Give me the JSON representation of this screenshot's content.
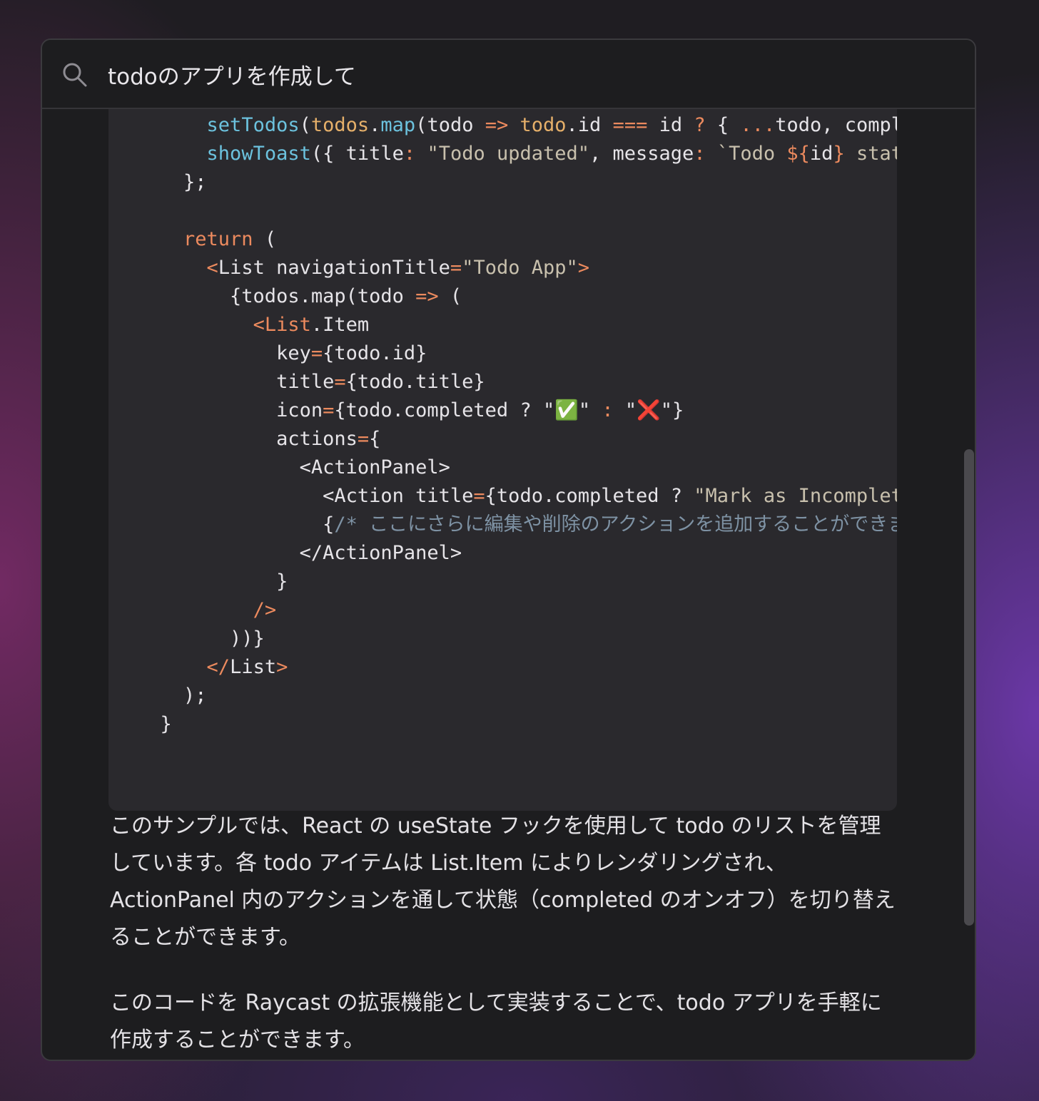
{
  "search": {
    "query": "todoのアプリを作成して"
  },
  "code": {
    "lines": [
      [
        {
          "t": "      "
        },
        {
          "t": "setTodos",
          "c": "tok-fn"
        },
        {
          "t": "("
        },
        {
          "t": "todos",
          "c": "tok-var"
        },
        {
          "t": "."
        },
        {
          "t": "map",
          "c": "tok-fn"
        },
        {
          "t": "(todo "
        },
        {
          "t": "=>",
          "c": "tok-op"
        },
        {
          "t": " "
        },
        {
          "t": "todo",
          "c": "tok-var"
        },
        {
          "t": ".id "
        },
        {
          "t": "===",
          "c": "tok-op"
        },
        {
          "t": " id "
        },
        {
          "t": "?",
          "c": "tok-op"
        },
        {
          "t": " { "
        },
        {
          "t": "...",
          "c": "tok-op"
        },
        {
          "t": "todo, compl"
        }
      ],
      [
        {
          "t": "      "
        },
        {
          "t": "showToast",
          "c": "tok-fn"
        },
        {
          "t": "({ title"
        },
        {
          "t": ":",
          "c": "tok-op"
        },
        {
          "t": " "
        },
        {
          "t": "\"Todo updated\"",
          "c": "tok-str"
        },
        {
          "t": ", message"
        },
        {
          "t": ":",
          "c": "tok-op"
        },
        {
          "t": " "
        },
        {
          "t": "`Todo ",
          "c": "tok-str"
        },
        {
          "t": "${",
          "c": "tok-op"
        },
        {
          "t": "id"
        },
        {
          "t": "}",
          "c": "tok-op"
        },
        {
          "t": " stat",
          "c": "tok-str"
        }
      ],
      [
        {
          "t": "    };"
        }
      ],
      [
        {
          "t": ""
        }
      ],
      [
        {
          "t": "    "
        },
        {
          "t": "return",
          "c": "tok-kw"
        },
        {
          "t": " ("
        }
      ],
      [
        {
          "t": "      "
        },
        {
          "t": "<",
          "c": "tok-op"
        },
        {
          "t": "List navigationTitle"
        },
        {
          "t": "=",
          "c": "tok-op"
        },
        {
          "t": "\"Todo App\"",
          "c": "tok-str"
        },
        {
          "t": ">",
          "c": "tok-op"
        }
      ],
      [
        {
          "t": "        {todos.map(todo "
        },
        {
          "t": "=>",
          "c": "tok-op"
        },
        {
          "t": " ("
        }
      ],
      [
        {
          "t": "          "
        },
        {
          "t": "<List",
          "c": "tok-op"
        },
        {
          "t": ".Item"
        }
      ],
      [
        {
          "t": "            key"
        },
        {
          "t": "=",
          "c": "tok-op"
        },
        {
          "t": "{todo.id}"
        }
      ],
      [
        {
          "t": "            title"
        },
        {
          "t": "=",
          "c": "tok-op"
        },
        {
          "t": "{todo.title}"
        }
      ],
      [
        {
          "t": "            icon"
        },
        {
          "t": "=",
          "c": "tok-op"
        },
        {
          "t": "{todo.completed ? \"✅\" "
        },
        {
          "t": ":",
          "c": "tok-op"
        },
        {
          "t": " \"❌\"}"
        }
      ],
      [
        {
          "t": "            actions"
        },
        {
          "t": "=",
          "c": "tok-op"
        },
        {
          "t": "{"
        }
      ],
      [
        {
          "t": "              <ActionPanel>"
        }
      ],
      [
        {
          "t": "                <Action title"
        },
        {
          "t": "=",
          "c": "tok-op"
        },
        {
          "t": "{todo.completed ? "
        },
        {
          "t": "\"Mark as Incomplet",
          "c": "tok-str"
        }
      ],
      [
        {
          "t": "                {"
        },
        {
          "t": "/* ここにさらに編集や削除のアクションを追加することができま",
          "c": "tok-cm"
        }
      ],
      [
        {
          "t": "              </ActionPanel>"
        }
      ],
      [
        {
          "t": "            }"
        }
      ],
      [
        {
          "t": "          "
        },
        {
          "t": "/>",
          "c": "tok-op"
        }
      ],
      [
        {
          "t": "        ))}"
        }
      ],
      [
        {
          "t": "      "
        },
        {
          "t": "</",
          "c": "tok-op"
        },
        {
          "t": "List"
        },
        {
          "t": ">",
          "c": "tok-op"
        }
      ],
      [
        {
          "t": "    );"
        }
      ],
      [
        {
          "t": "  }"
        }
      ]
    ]
  },
  "explanation": {
    "paragraph_1": "このサンプルでは、React の useState フックを使用して todo のリストを管理しています。各 todo アイテムは List.Item によりレンダリングされ、ActionPanel 内のアクションを通して状態（completed のオンオフ）を切り替えることができます。",
    "paragraph_2": "このコードを Raycast の拡張機能として実装することで、todo アプリを手軽に作成することができます。"
  }
}
